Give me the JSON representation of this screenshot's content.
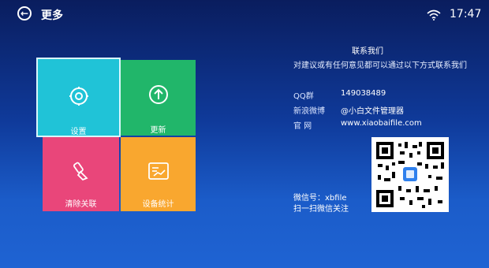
{
  "header": {
    "back_icon": "arrow-left-icon",
    "title": "更多",
    "status_icon": "wifi-icon",
    "time": "17:47"
  },
  "tiles": [
    {
      "label": "设置",
      "icon": "gear-icon",
      "color": "#20c3d7"
    },
    {
      "label": "更新",
      "icon": "upload-arrow-icon",
      "color": "#21b66a"
    },
    {
      "label": "清除关联",
      "icon": "broom-icon",
      "color": "#e9467a"
    },
    {
      "label": "设备统计",
      "icon": "chart-box-icon",
      "color": "#f9a72f"
    }
  ],
  "contact": {
    "title": "联系我们",
    "intro": "对建议或有任何意见都可以通过以下方式联系我们",
    "rows": [
      {
        "label": "QQ群",
        "value": "149038489"
      },
      {
        "label": "新浪微博",
        "value": "@小白文件管理器"
      },
      {
        "label": "官 网",
        "value": "www.xiaobaifile.com"
      }
    ],
    "wechat_id": "微信号：xbfile",
    "wechat_hint": "扫一扫微信关注"
  }
}
